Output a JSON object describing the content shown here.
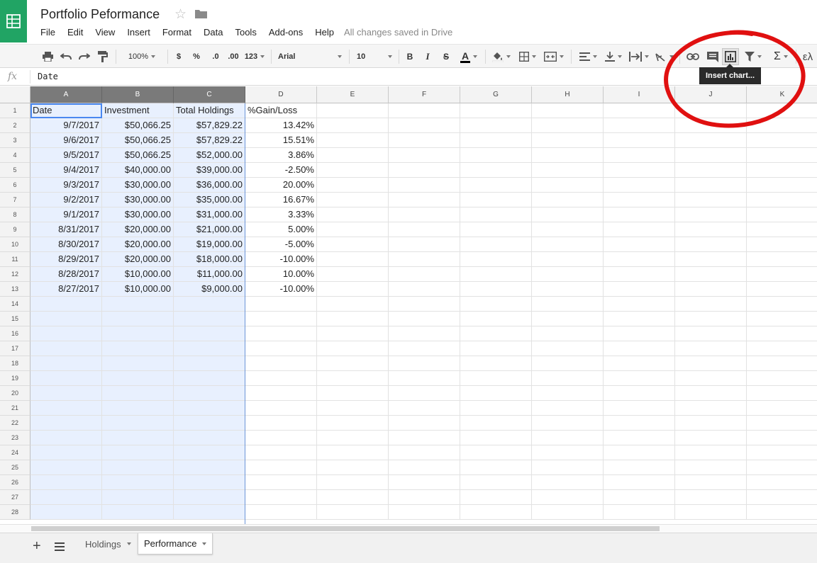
{
  "app": {
    "title": "Portfolio Peformance",
    "save_status": "All changes saved in Drive"
  },
  "menu": [
    "File",
    "Edit",
    "View",
    "Insert",
    "Format",
    "Data",
    "Tools",
    "Add-ons",
    "Help"
  ],
  "toolbar": {
    "zoom": "100%",
    "currency": "$",
    "percent": "%",
    "decimal_decrease": ".0",
    "decimal_increase": ".00",
    "more_formats": "123",
    "font": "Arial",
    "font_size": "10",
    "bold": "B",
    "italic": "I",
    "strike": "S",
    "text_color": "A",
    "functions": "Σ",
    "input_tools": "ελ",
    "text_color_value": "#000000"
  },
  "tooltip": "Insert chart...",
  "formula_bar": {
    "fx": "fx",
    "value": "Date"
  },
  "columns": [
    "A",
    "B",
    "C",
    "D",
    "E",
    "F",
    "G",
    "H",
    "I",
    "J",
    "K"
  ],
  "rows": [
    [
      "Date",
      "Investment",
      "Total Holdings",
      "%Gain/Loss"
    ],
    [
      "9/7/2017",
      "$50,066.25",
      "$57,829.22",
      "13.42%"
    ],
    [
      "9/6/2017",
      "$50,066.25",
      "$57,829.22",
      "15.51%"
    ],
    [
      "9/5/2017",
      "$50,066.25",
      "$52,000.00",
      "3.86%"
    ],
    [
      "9/4/2017",
      "$40,000.00",
      "$39,000.00",
      "-2.50%"
    ],
    [
      "9/3/2017",
      "$30,000.00",
      "$36,000.00",
      "20.00%"
    ],
    [
      "9/2/2017",
      "$30,000.00",
      "$35,000.00",
      "16.67%"
    ],
    [
      "9/1/2017",
      "$30,000.00",
      "$31,000.00",
      "3.33%"
    ],
    [
      "8/31/2017",
      "$20,000.00",
      "$21,000.00",
      "5.00%"
    ],
    [
      "8/30/2017",
      "$20,000.00",
      "$19,000.00",
      "-5.00%"
    ],
    [
      "8/29/2017",
      "$20,000.00",
      "$18,000.00",
      "-10.00%"
    ],
    [
      "8/28/2017",
      "$10,000.00",
      "$11,000.00",
      "10.00%"
    ],
    [
      "8/27/2017",
      "$10,000.00",
      "$9,000.00",
      "-10.00%"
    ]
  ],
  "row_numbers": [
    "1",
    "2",
    "3",
    "4",
    "5",
    "6",
    "7",
    "8",
    "9",
    "10",
    "11",
    "12",
    "13",
    "14",
    "15",
    "16",
    "17",
    "18",
    "19",
    "20",
    "21",
    "22",
    "23",
    "24",
    "25",
    "26",
    "27",
    "28"
  ],
  "sheets": [
    "Holdings",
    "Performance"
  ],
  "colors": {
    "brand_green": "#21a464",
    "selection": "#e8f0fe",
    "active_border": "#4a88f0",
    "annotation": "#e01010"
  }
}
